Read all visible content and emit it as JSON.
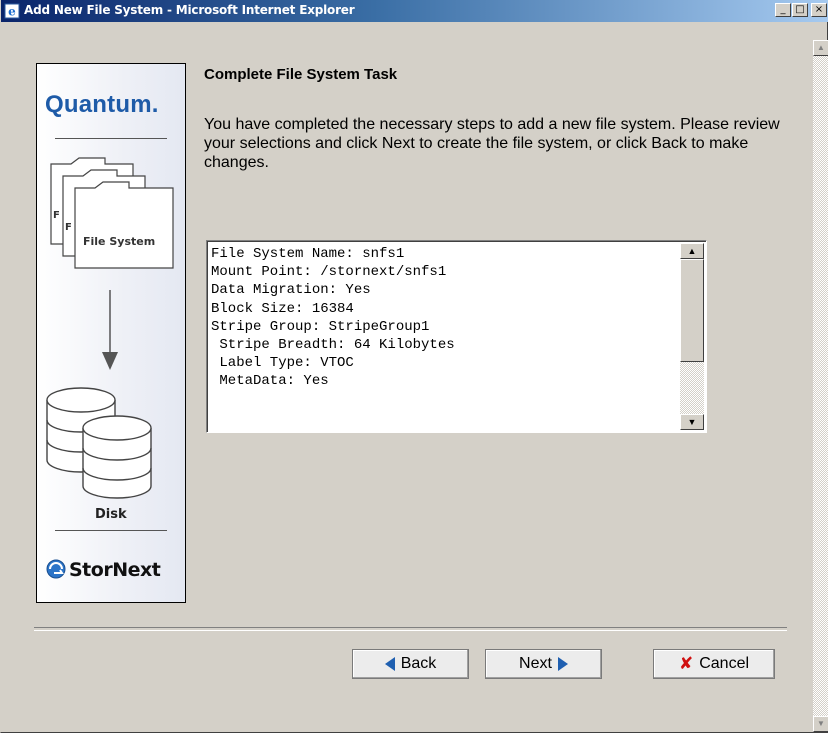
{
  "window": {
    "title": "Add New File System - Microsoft Internet Explorer",
    "controls": {
      "minimize": "_",
      "maximize": "□",
      "close": "×"
    }
  },
  "sidebar": {
    "logo": "Quantum.",
    "file_system_label": "File System",
    "disk_label": "Disk",
    "brand": "StorNext",
    "colors": {
      "quantum_blue": "#1e5ba8"
    }
  },
  "main": {
    "heading": "Complete File System Task",
    "description": "You have completed the necessary steps to add a new file system. Please review your selections and click Next to create the file system, or click Back to make changes.",
    "summary_lines": [
      "File System Name: snfs1",
      "Mount Point: /stornext/snfs1",
      "Data Migration: Yes",
      "Block Size: 16384",
      "Stripe Group: StripeGroup1",
      " Stripe Breadth: 64 Kilobytes",
      " Label Type: VTOC",
      " MetaData: Yes"
    ]
  },
  "buttons": {
    "back": "Back",
    "next": "Next",
    "cancel": "Cancel"
  }
}
